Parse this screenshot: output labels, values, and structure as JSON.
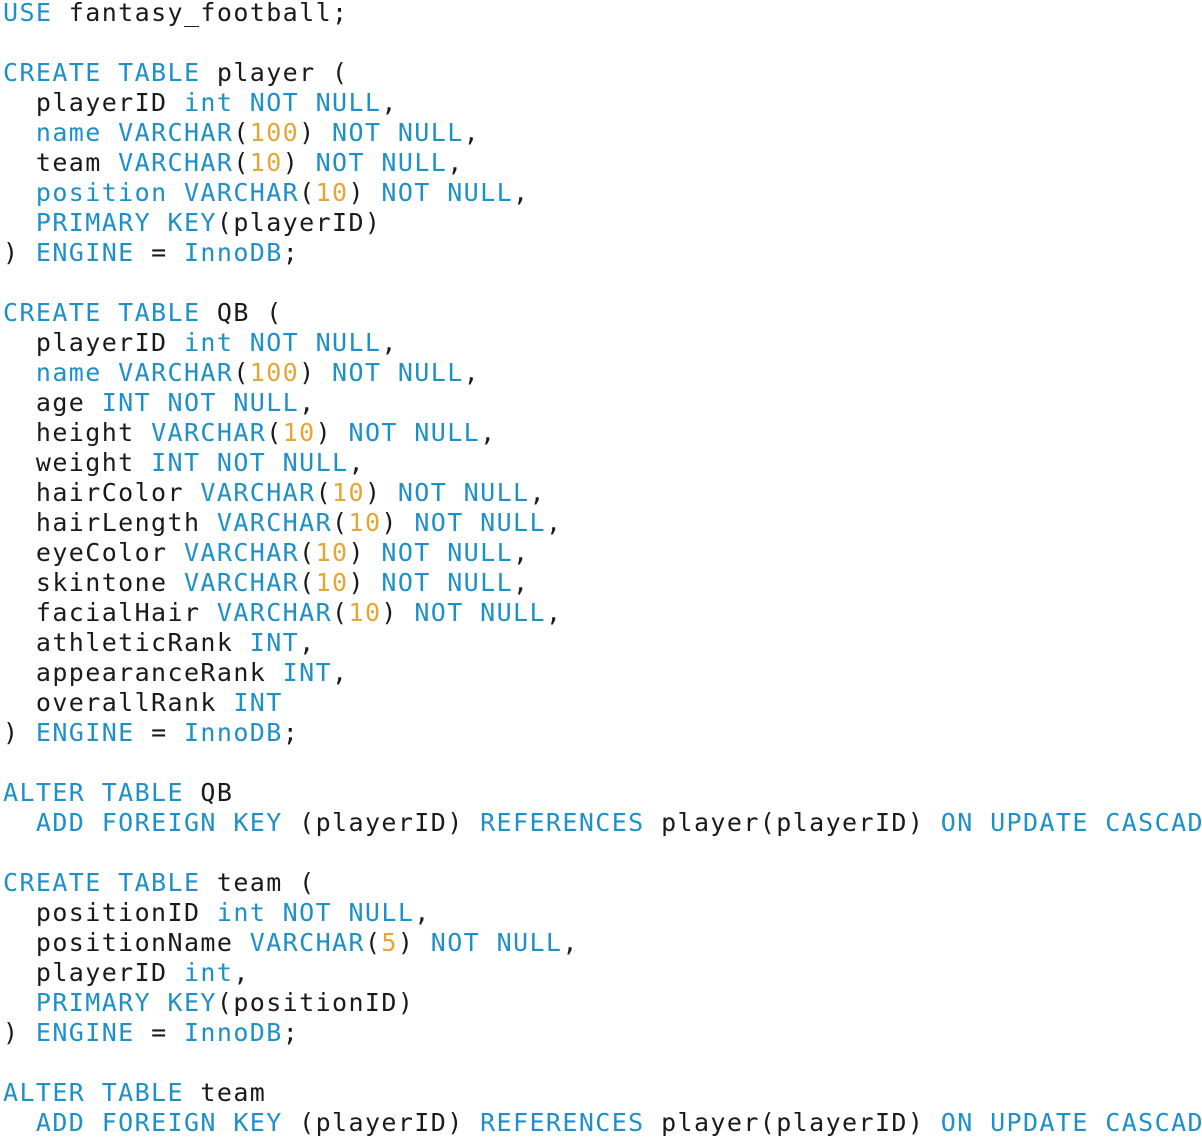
{
  "colors": {
    "keyword": "#1e90c8",
    "number": "#e7a535",
    "text": "#1a1a1a",
    "background": "#ffffff"
  },
  "code_lines": [
    [
      [
        "k",
        "USE"
      ],
      [
        "t",
        " fantasy_football;"
      ]
    ],
    [],
    [
      [
        "k",
        "CREATE TABLE"
      ],
      [
        "t",
        " player ("
      ]
    ],
    [
      [
        "t",
        "  playerID "
      ],
      [
        "k",
        "int NOT NULL"
      ],
      [
        "t",
        ","
      ]
    ],
    [
      [
        "t",
        "  "
      ],
      [
        "k",
        "name VARCHAR"
      ],
      [
        "t",
        "("
      ],
      [
        "n",
        "100"
      ],
      [
        "t",
        ") "
      ],
      [
        "k",
        "NOT NULL"
      ],
      [
        "t",
        ","
      ]
    ],
    [
      [
        "t",
        "  team "
      ],
      [
        "k",
        "VARCHAR"
      ],
      [
        "t",
        "("
      ],
      [
        "n",
        "10"
      ],
      [
        "t",
        ") "
      ],
      [
        "k",
        "NOT NULL"
      ],
      [
        "t",
        ","
      ]
    ],
    [
      [
        "t",
        "  "
      ],
      [
        "k",
        "position VARCHAR"
      ],
      [
        "t",
        "("
      ],
      [
        "n",
        "10"
      ],
      [
        "t",
        ") "
      ],
      [
        "k",
        "NOT NULL"
      ],
      [
        "t",
        ","
      ]
    ],
    [
      [
        "t",
        "  "
      ],
      [
        "k",
        "PRIMARY KEY"
      ],
      [
        "t",
        "(playerID)"
      ]
    ],
    [
      [
        "t",
        ") "
      ],
      [
        "k",
        "ENGINE"
      ],
      [
        "t",
        " = "
      ],
      [
        "k",
        "InnoDB"
      ],
      [
        "t",
        ";"
      ]
    ],
    [],
    [
      [
        "k",
        "CREATE TABLE"
      ],
      [
        "t",
        " QB ("
      ]
    ],
    [
      [
        "t",
        "  playerID "
      ],
      [
        "k",
        "int NOT NULL"
      ],
      [
        "t",
        ","
      ]
    ],
    [
      [
        "t",
        "  "
      ],
      [
        "k",
        "name VARCHAR"
      ],
      [
        "t",
        "("
      ],
      [
        "n",
        "100"
      ],
      [
        "t",
        ") "
      ],
      [
        "k",
        "NOT NULL"
      ],
      [
        "t",
        ","
      ]
    ],
    [
      [
        "t",
        "  age "
      ],
      [
        "k",
        "INT NOT NULL"
      ],
      [
        "t",
        ","
      ]
    ],
    [
      [
        "t",
        "  height "
      ],
      [
        "k",
        "VARCHAR"
      ],
      [
        "t",
        "("
      ],
      [
        "n",
        "10"
      ],
      [
        "t",
        ") "
      ],
      [
        "k",
        "NOT NULL"
      ],
      [
        "t",
        ","
      ]
    ],
    [
      [
        "t",
        "  weight "
      ],
      [
        "k",
        "INT NOT NULL"
      ],
      [
        "t",
        ","
      ]
    ],
    [
      [
        "t",
        "  hairColor "
      ],
      [
        "k",
        "VARCHAR"
      ],
      [
        "t",
        "("
      ],
      [
        "n",
        "10"
      ],
      [
        "t",
        ") "
      ],
      [
        "k",
        "NOT NULL"
      ],
      [
        "t",
        ","
      ]
    ],
    [
      [
        "t",
        "  hairLength "
      ],
      [
        "k",
        "VARCHAR"
      ],
      [
        "t",
        "("
      ],
      [
        "n",
        "10"
      ],
      [
        "t",
        ") "
      ],
      [
        "k",
        "NOT NULL"
      ],
      [
        "t",
        ","
      ]
    ],
    [
      [
        "t",
        "  eyeColor "
      ],
      [
        "k",
        "VARCHAR"
      ],
      [
        "t",
        "("
      ],
      [
        "n",
        "10"
      ],
      [
        "t",
        ") "
      ],
      [
        "k",
        "NOT NULL"
      ],
      [
        "t",
        ","
      ]
    ],
    [
      [
        "t",
        "  skintone "
      ],
      [
        "k",
        "VARCHAR"
      ],
      [
        "t",
        "("
      ],
      [
        "n",
        "10"
      ],
      [
        "t",
        ") "
      ],
      [
        "k",
        "NOT NULL"
      ],
      [
        "t",
        ","
      ]
    ],
    [
      [
        "t",
        "  facialHair "
      ],
      [
        "k",
        "VARCHAR"
      ],
      [
        "t",
        "("
      ],
      [
        "n",
        "10"
      ],
      [
        "t",
        ") "
      ],
      [
        "k",
        "NOT NULL"
      ],
      [
        "t",
        ","
      ]
    ],
    [
      [
        "t",
        "  athleticRank "
      ],
      [
        "k",
        "INT"
      ],
      [
        "t",
        ","
      ]
    ],
    [
      [
        "t",
        "  appearanceRank "
      ],
      [
        "k",
        "INT"
      ],
      [
        "t",
        ","
      ]
    ],
    [
      [
        "t",
        "  overallRank "
      ],
      [
        "k",
        "INT"
      ]
    ],
    [
      [
        "t",
        ") "
      ],
      [
        "k",
        "ENGINE"
      ],
      [
        "t",
        " = "
      ],
      [
        "k",
        "InnoDB"
      ],
      [
        "t",
        ";"
      ]
    ],
    [],
    [
      [
        "k",
        "ALTER TABLE"
      ],
      [
        "t",
        " QB"
      ]
    ],
    [
      [
        "t",
        "  "
      ],
      [
        "k",
        "ADD FOREIGN KEY"
      ],
      [
        "t",
        " (playerID) "
      ],
      [
        "k",
        "REFERENCES"
      ],
      [
        "t",
        " player(playerID) "
      ],
      [
        "k",
        "ON UPDATE CASCADE"
      ],
      [
        "t",
        ";"
      ]
    ],
    [],
    [
      [
        "k",
        "CREATE TABLE"
      ],
      [
        "t",
        " team ("
      ]
    ],
    [
      [
        "t",
        "  positionID "
      ],
      [
        "k",
        "int NOT NULL"
      ],
      [
        "t",
        ","
      ]
    ],
    [
      [
        "t",
        "  positionName "
      ],
      [
        "k",
        "VARCHAR"
      ],
      [
        "t",
        "("
      ],
      [
        "n",
        "5"
      ],
      [
        "t",
        ") "
      ],
      [
        "k",
        "NOT NULL"
      ],
      [
        "t",
        ","
      ]
    ],
    [
      [
        "t",
        "  playerID "
      ],
      [
        "k",
        "int"
      ],
      [
        "t",
        ","
      ]
    ],
    [
      [
        "t",
        "  "
      ],
      [
        "k",
        "PRIMARY KEY"
      ],
      [
        "t",
        "(positionID)"
      ]
    ],
    [
      [
        "t",
        ") "
      ],
      [
        "k",
        "ENGINE"
      ],
      [
        "t",
        " = "
      ],
      [
        "k",
        "InnoDB"
      ],
      [
        "t",
        ";"
      ]
    ],
    [],
    [
      [
        "k",
        "ALTER TABLE"
      ],
      [
        "t",
        " team"
      ]
    ],
    [
      [
        "t",
        "  "
      ],
      [
        "k",
        "ADD FOREIGN KEY"
      ],
      [
        "t",
        " (playerID) "
      ],
      [
        "k",
        "REFERENCES"
      ],
      [
        "t",
        " player(playerID) "
      ],
      [
        "k",
        "ON UPDATE CASCADE"
      ],
      [
        "t",
        ";"
      ]
    ]
  ]
}
